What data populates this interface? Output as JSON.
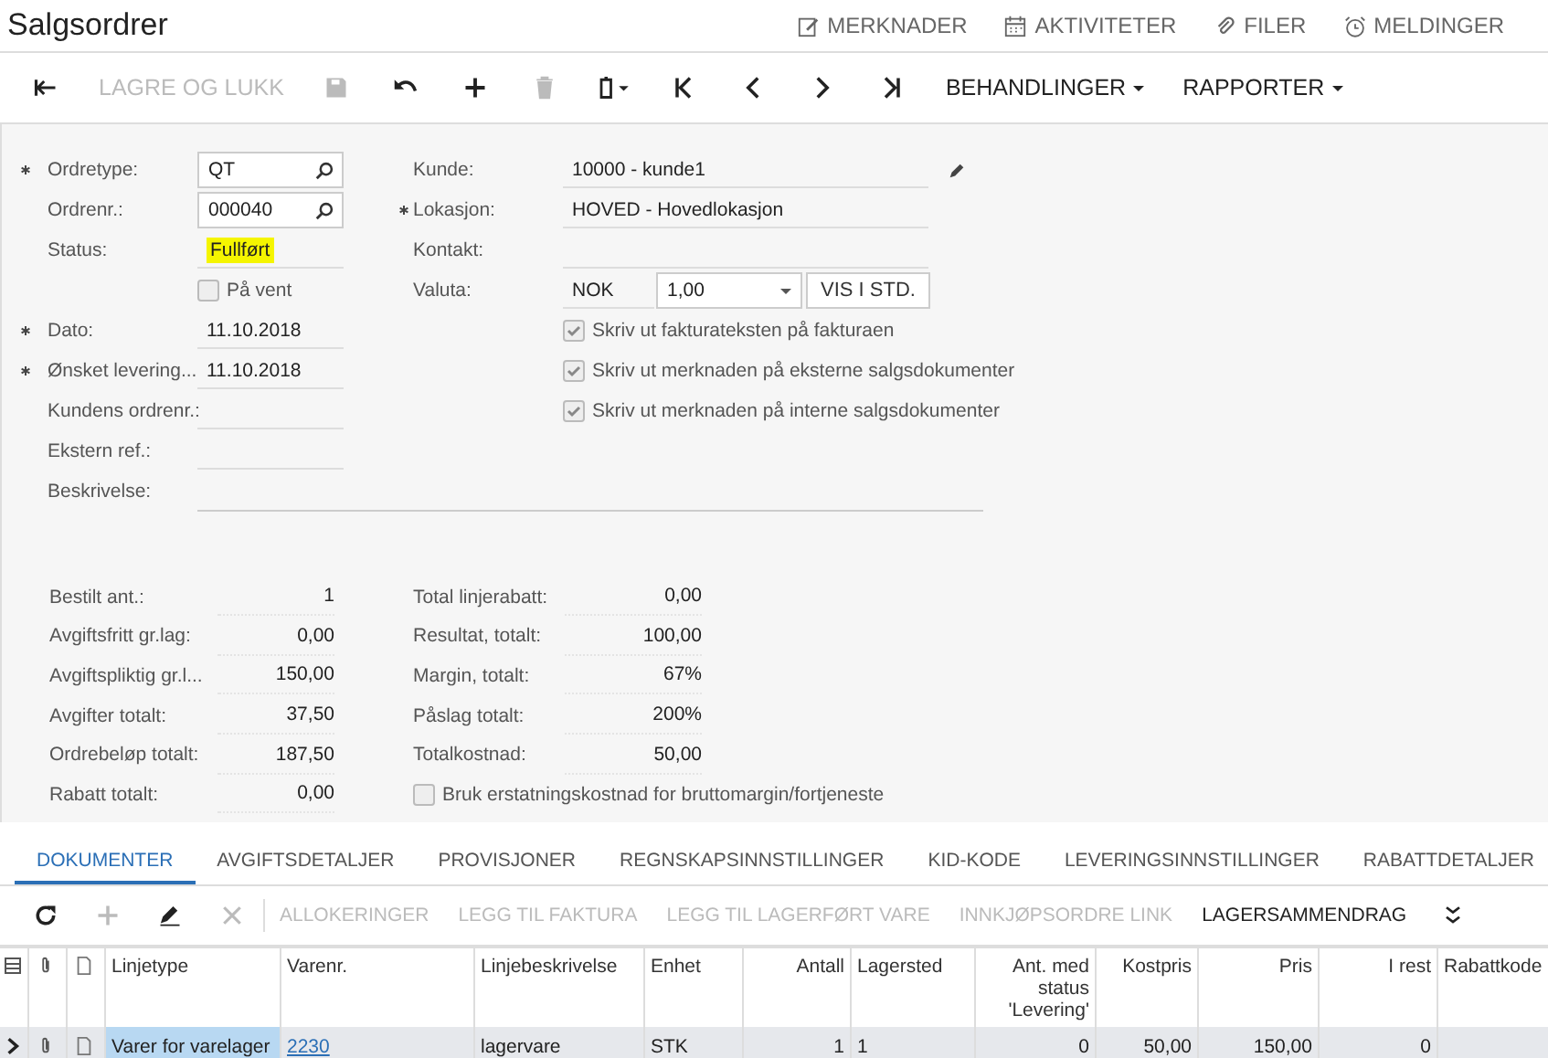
{
  "window": {
    "title": "Salgsordrer"
  },
  "header_links": [
    {
      "kind": "note",
      "label": "MERKNADER"
    },
    {
      "kind": "calendar",
      "label": "AKTIVITETER"
    },
    {
      "kind": "clip",
      "label": "FILER"
    },
    {
      "kind": "alarm",
      "label": "MELDINGER"
    }
  ],
  "toolbar": [
    {
      "kind": "back",
      "disabled": false
    },
    {
      "kind": "text",
      "label": "LAGRE OG LUKK",
      "disabled": true
    },
    {
      "kind": "save",
      "disabled": true
    },
    {
      "kind": "undo",
      "disabled": false
    },
    {
      "kind": "add",
      "disabled": false
    },
    {
      "kind": "delete",
      "disabled": true
    },
    {
      "kind": "paste",
      "disabled": false
    },
    {
      "kind": "first",
      "disabled": false
    },
    {
      "kind": "prev",
      "disabled": false
    },
    {
      "kind": "next",
      "disabled": false
    },
    {
      "kind": "last",
      "disabled": false
    },
    {
      "kind": "menu",
      "label": "BEHANDLINGER",
      "disabled": false
    },
    {
      "kind": "menu",
      "label": "RAPPORTER",
      "disabled": false
    }
  ],
  "form_left": [
    {
      "label": "Ordretype:",
      "required": true,
      "kind": "lookup",
      "value": "QT"
    },
    {
      "label": "Ordrenr.:",
      "required": false,
      "kind": "lookup",
      "value": "000040"
    },
    {
      "label": "Status:",
      "required": false,
      "kind": "status",
      "value": "Fullført"
    },
    {
      "kind": "checkbox",
      "label": "På vent",
      "checked": false
    },
    {
      "label": "Dato:",
      "required": true,
      "kind": "text",
      "value": "11.10.2018"
    },
    {
      "label": "Ønsket levering...",
      "required": true,
      "kind": "text",
      "value": "11.10.2018"
    },
    {
      "label": "Kundens ordrenr.:",
      "required": false,
      "kind": "text"
    },
    {
      "label": "Ekstern ref.:",
      "required": false,
      "kind": "text"
    }
  ],
  "form_right": [
    {
      "label": "Kunde:",
      "required": false,
      "value": "10000 - kunde1"
    },
    {
      "label": "Lokasjon:",
      "required": true,
      "value": "HOVED - Hovedlokasjon"
    },
    {
      "label": "Kontakt:",
      "required": false
    }
  ],
  "currency": {
    "label": "Valuta:",
    "code": "NOK",
    "rate": "1,00",
    "button": "VIS I STD."
  },
  "print_options": [
    {
      "label": "Skriv ut fakturateksten på fakturaen",
      "checked": true
    },
    {
      "label": "Skriv ut merknaden på eksterne salgsdokumenter",
      "checked": true
    },
    {
      "label": "Skriv ut merknaden på interne salgsdokumenter",
      "checked": true
    }
  ],
  "description": {
    "label": "Beskrivelse:"
  },
  "totals_left": [
    {
      "label": "Bestilt ant.:",
      "value": "1"
    },
    {
      "label": "Avgiftsfritt gr.lag:",
      "value": "0,00"
    },
    {
      "label": "Avgiftspliktig gr.l...",
      "value": "150,00"
    },
    {
      "label": "Avgifter totalt:",
      "value": "37,50"
    },
    {
      "label": "Ordrebeløp totalt:",
      "value": "187,50"
    },
    {
      "label": "Rabatt totalt:",
      "value": "0,00"
    }
  ],
  "totals_right": [
    {
      "label": "Total linjerabatt:",
      "value": "0,00"
    },
    {
      "label": "Resultat, totalt:",
      "value": "100,00"
    },
    {
      "label": "Margin, totalt:",
      "value": "67%"
    },
    {
      "label": "Påslag totalt:",
      "value": "200%"
    },
    {
      "label": "Totalkostnad:",
      "value": "50,00"
    }
  ],
  "replacement_cost": {
    "label": "Bruk erstatningskostnad for bruttomargin/fortjeneste",
    "checked": false
  },
  "tabs": [
    {
      "label": "DOKUMENTER",
      "selected": true
    },
    {
      "label": "AVGIFTSDETALJER",
      "selected": false
    },
    {
      "label": "PROVISJONER",
      "selected": false
    },
    {
      "label": "REGNSKAPSINNSTILLINGER",
      "selected": false
    },
    {
      "label": "KID-KODE",
      "selected": false
    },
    {
      "label": "LEVERINGSINNSTILLINGER",
      "selected": false
    },
    {
      "label": "RABATTDETALJER",
      "selected": false
    }
  ],
  "grid_toolbar": [
    {
      "kind": "refresh",
      "disabled": false
    },
    {
      "kind": "add",
      "disabled": true
    },
    {
      "kind": "edit",
      "disabled": false
    },
    {
      "kind": "delete",
      "disabled": true
    },
    {
      "kind": "text",
      "label": "ALLOKERINGER",
      "disabled": true
    },
    {
      "kind": "text",
      "label": "LEGG TIL FAKTURA",
      "disabled": true
    },
    {
      "kind": "text",
      "label": "LEGG TIL LAGERFØRT VARE",
      "disabled": true
    },
    {
      "kind": "text",
      "label": "INNKJØPSORDRE LINK",
      "disabled": true
    },
    {
      "kind": "text",
      "label": "LAGERSAMMENDRAG",
      "disabled": false
    },
    {
      "kind": "more",
      "disabled": false
    }
  ],
  "table": {
    "columns": [
      "Linjetype",
      "Varenr.",
      "Linjebeskrivelse",
      "Enhet",
      "Antall",
      "Lagersted",
      "Ant. med status 'Levering'",
      "Kostpris",
      "Pris",
      "I rest",
      "Rabattkode"
    ],
    "rows": [
      {
        "selected": true,
        "cells": [
          "Varer for varelager",
          "2230",
          "lagervare",
          "STK",
          "1",
          "1",
          "0",
          "50,00",
          "150,00",
          "0",
          ""
        ]
      }
    ]
  }
}
